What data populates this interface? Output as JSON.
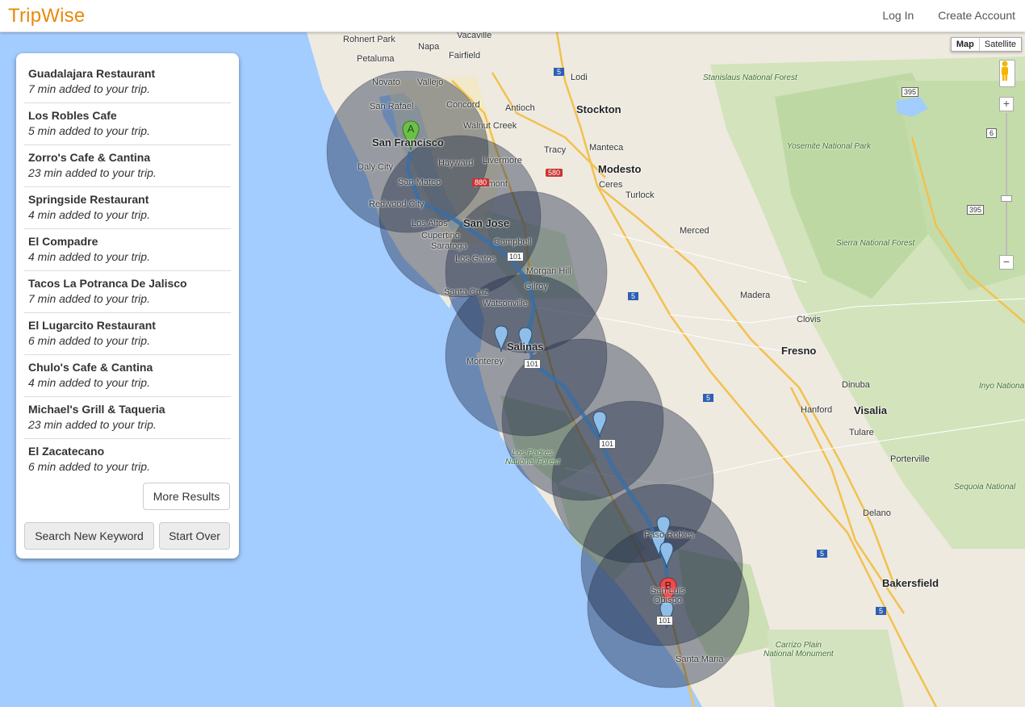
{
  "brand": "TripWise",
  "nav": {
    "login": "Log In",
    "create_account": "Create Account"
  },
  "map_type": {
    "map": "Map",
    "satellite": "Satellite"
  },
  "zoom": {
    "in": "+",
    "out": "−"
  },
  "results": [
    {
      "name": "Guadalajara Restaurant",
      "added": "7 min added to your trip."
    },
    {
      "name": "Los Robles Cafe",
      "added": "5 min added to your trip."
    },
    {
      "name": "Zorro's Cafe & Cantina",
      "added": "23 min added to your trip."
    },
    {
      "name": "Springside Restaurant",
      "added": "4 min added to your trip."
    },
    {
      "name": "El Compadre",
      "added": "4 min added to your trip."
    },
    {
      "name": "Tacos La Potranca De Jalisco",
      "added": "7 min added to your trip."
    },
    {
      "name": "El Lugarcito Restaurant",
      "added": "6 min added to your trip."
    },
    {
      "name": "Chulo's Cafe & Cantina",
      "added": "4 min added to your trip."
    },
    {
      "name": "Michael's Grill & Taqueria",
      "added": "23 min added to your trip."
    },
    {
      "name": "El Zacatecano",
      "added": "6 min added to your trip."
    }
  ],
  "buttons": {
    "more_results": "More Results",
    "search_new": "Search New Keyword",
    "start_over": "Start Over"
  },
  "markers": {
    "start": "A",
    "end": "B"
  },
  "colors": {
    "brand": "#e8890c",
    "route": "#3a6ea5",
    "start_marker": "#6cc04a",
    "end_marker": "#e84c4c",
    "poi_marker": "#8fbfe8",
    "water": "#a3ccff"
  },
  "map_labels": {
    "rohnert_park": "Rohnert Park",
    "napa": "Napa",
    "vacaville": "Vacaville",
    "petaluma": "Petaluma",
    "fairfield": "Fairfield",
    "novato": "Novato",
    "vallejo": "Vallejo",
    "lodi": "Lodi",
    "san_rafael": "San Rafael",
    "concord": "Concord",
    "antioch": "Antioch",
    "stockton": "Stockton",
    "walnut_creek": "Walnut Creek",
    "san_francisco": "San Francisco",
    "manteca": "Manteca",
    "tracy": "Tracy",
    "daly_city": "Daly City",
    "hayward": "Hayward",
    "livermore": "Livermore",
    "san_mateo": "San Mateo",
    "fremont": "Fremont",
    "modesto": "Modesto",
    "ceres": "Ceres",
    "redwood_city": "Redwood City",
    "turlock": "Turlock",
    "los_altos": "Los Altos",
    "san_jose": "San Jose",
    "cupertino": "Cupertino",
    "saratoga": "Saratoga",
    "campbell": "Campbell",
    "merced": "Merced",
    "los_gatos": "Los Gatos",
    "morgan_hill": "Morgan Hill",
    "gilroy": "Gilroy",
    "santa_cruz": "Santa Cruz",
    "watsonville": "Watsonville",
    "madera": "Madera",
    "salinas": "Salinas",
    "monterey": "Monterey",
    "clovis": "Clovis",
    "fresno": "Fresno",
    "dinuba": "Dinuba",
    "hanford": "Hanford",
    "visalia": "Visalia",
    "tulare": "Tulare",
    "porterville": "Porterville",
    "los_padres": "Los Padres\nNational Forest",
    "delano": "Delano",
    "paso_robles": "Paso Robles",
    "bakersfield": "Bakersfield",
    "san_luis_obispo": "San Luis\nObispo",
    "santa_maria": "Santa Maria",
    "stanislaus": "Stanislaus National Forest",
    "yosemite": "Yosemite National Park",
    "sierra": "Sierra National Forest",
    "sequoia": "Sequoia National",
    "inyo": "Inyo Nationa",
    "carrizo": "Carrizo Plain\nNational Monument",
    "hw580": "580",
    "hw880": "880",
    "hw101a": "101",
    "hw101b": "101",
    "hw101c": "101",
    "hw101d": "101",
    "i5a": "5",
    "i5b": "5",
    "i5c": "5",
    "i5d": "5",
    "i5e": "5",
    "hw395a": "395",
    "hw395b": "395",
    "hw6": "6"
  }
}
